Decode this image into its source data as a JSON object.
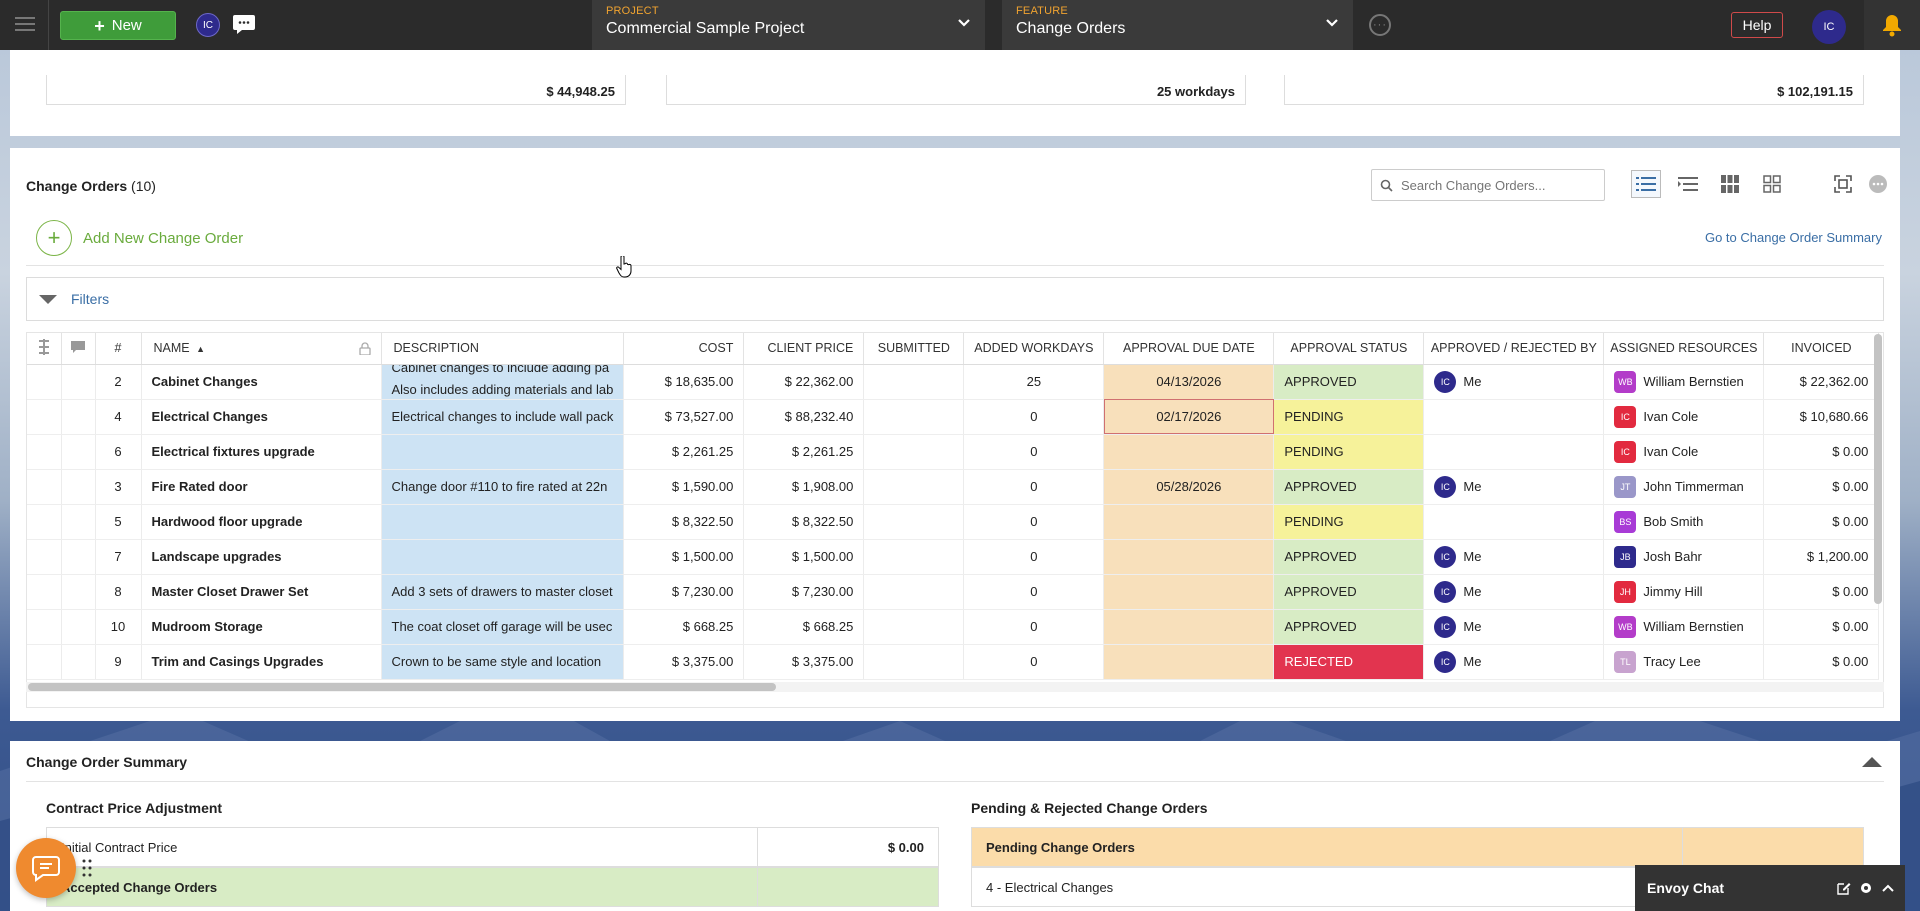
{
  "topbar": {
    "new_label": "New",
    "avatar_initials": "IC",
    "project": {
      "label": "PROJECT",
      "value": "Commercial Sample Project"
    },
    "feature": {
      "label": "FEATURE",
      "value": "Change Orders"
    },
    "help_label": "Help",
    "user_initials": "IC"
  },
  "totals": [
    "$ 44,948.25",
    "25 workdays",
    "$ 102,191.15"
  ],
  "change_orders": {
    "title": "Change Orders",
    "count": "(10)",
    "search_placeholder": "Search Change Orders...",
    "add_label": "Add New Change Order",
    "goto_label": "Go to Change Order Summary",
    "filters_label": "Filters",
    "columns": [
      "#",
      "NAME",
      "DESCRIPTION",
      "COST",
      "CLIENT PRICE",
      "SUBMITTED",
      "ADDED WORKDAYS",
      "APPROVAL DUE DATE",
      "APPROVAL STATUS",
      "APPROVED / REJECTED BY",
      "ASSIGNED RESOURCES",
      "INVOICED"
    ],
    "rows": [
      {
        "num": "2",
        "name": "Cabinet Changes",
        "desc": "Cabinet changes to include adding pa",
        "desc2": "Also includes adding materials and lab",
        "cost": "$ 18,635.00",
        "price": "$ 22,362.00",
        "submitted": "",
        "workdays": "25",
        "due": "04/13/2026",
        "status": "APPROVED",
        "by": "Me",
        "by_initials": "IC",
        "resource": "William Bernstien",
        "res_initials": "WB",
        "res_color": "#b33cc9",
        "invoiced": "$ 22,362.00"
      },
      {
        "num": "4",
        "name": "Electrical Changes",
        "desc": "Electrical changes to include wall pack",
        "cost": "$ 73,527.00",
        "price": "$ 88,232.40",
        "submitted": "",
        "workdays": "0",
        "due": "02/17/2026",
        "status": "PENDING",
        "by": "",
        "by_initials": "",
        "resource": "Ivan Cole",
        "res_initials": "IC",
        "res_color": "#e22a3f",
        "invoiced": "$ 10,680.66"
      },
      {
        "num": "6",
        "name": "Electrical fixtures upgrade",
        "desc": "",
        "cost": "$ 2,261.25",
        "price": "$ 2,261.25",
        "submitted": "",
        "workdays": "0",
        "due": "",
        "status": "PENDING",
        "by": "",
        "by_initials": "",
        "resource": "Ivan Cole",
        "res_initials": "IC",
        "res_color": "#e22a3f",
        "invoiced": "$ 0.00"
      },
      {
        "num": "3",
        "name": "Fire Rated door",
        "desc": "Change door #110 to fire rated at 22n",
        "cost": "$ 1,590.00",
        "price": "$ 1,908.00",
        "submitted": "",
        "workdays": "0",
        "due": "05/28/2026",
        "status": "APPROVED",
        "by": "Me",
        "by_initials": "IC",
        "resource": "John Timmerman",
        "res_initials": "JT",
        "res_color": "#9a97c9",
        "invoiced": "$ 0.00"
      },
      {
        "num": "5",
        "name": "Hardwood floor upgrade",
        "desc": "",
        "cost": "$ 8,322.50",
        "price": "$ 8,322.50",
        "submitted": "",
        "workdays": "0",
        "due": "",
        "status": "PENDING",
        "by": "",
        "by_initials": "",
        "resource": "Bob Smith",
        "res_initials": "BS",
        "res_color": "#a83bd6",
        "invoiced": "$ 0.00"
      },
      {
        "num": "7",
        "name": "Landscape upgrades",
        "desc": "",
        "cost": "$ 1,500.00",
        "price": "$ 1,500.00",
        "submitted": "",
        "workdays": "0",
        "due": "",
        "status": "APPROVED",
        "by": "Me",
        "by_initials": "IC",
        "resource": "Josh Bahr",
        "res_initials": "JB",
        "res_color": "#2e2a8c",
        "invoiced": "$ 1,200.00"
      },
      {
        "num": "8",
        "name": "Master Closet Drawer Set",
        "desc": "Add 3 sets of drawers to master closet",
        "cost": "$ 7,230.00",
        "price": "$ 7,230.00",
        "submitted": "",
        "workdays": "0",
        "due": "",
        "status": "APPROVED",
        "by": "Me",
        "by_initials": "IC",
        "resource": "Jimmy Hill",
        "res_initials": "JH",
        "res_color": "#e22a3f",
        "invoiced": "$ 0.00"
      },
      {
        "num": "10",
        "name": "Mudroom Storage",
        "desc": "The coat closet off garage will be usec",
        "cost": "$ 668.25",
        "price": "$ 668.25",
        "submitted": "",
        "workdays": "0",
        "due": "",
        "status": "APPROVED",
        "by": "Me",
        "by_initials": "IC",
        "resource": "William Bernstien",
        "res_initials": "WB",
        "res_color": "#b33cc9",
        "invoiced": "$ 0.00"
      },
      {
        "num": "9",
        "name": "Trim and Casings Upgrades",
        "desc": "Crown to be same style and location",
        "cost": "$ 3,375.00",
        "price": "$ 3,375.00",
        "submitted": "",
        "workdays": "0",
        "due": "",
        "status": "REJECTED",
        "by": "Me",
        "by_initials": "IC",
        "resource": "Tracy Lee",
        "res_initials": "TL",
        "res_color": "#c8a3cf",
        "invoiced": "$ 0.00"
      }
    ]
  },
  "summary": {
    "title": "Change Order Summary",
    "left_title": "Contract Price Adjustment",
    "left_rows": [
      {
        "label": "Initial Contract Price",
        "value": "$ 0.00"
      },
      {
        "label": "Accepted Change Orders",
        "value": ""
      }
    ],
    "right_title": "Pending & Rejected Change Orders",
    "right_rows": [
      {
        "label": "Pending Change Orders",
        "value": ""
      },
      {
        "label": "4 - Electrical Changes",
        "value": ""
      }
    ]
  },
  "envoy": {
    "label": "Envoy Chat"
  },
  "colors": {
    "accent_green": "#3f9c3a",
    "approved": "#d8ecc5",
    "pending": "#f6f29a",
    "rejected": "#e2344f",
    "due_bg": "#f8e0bb",
    "desc_bg": "#cde3f4"
  }
}
